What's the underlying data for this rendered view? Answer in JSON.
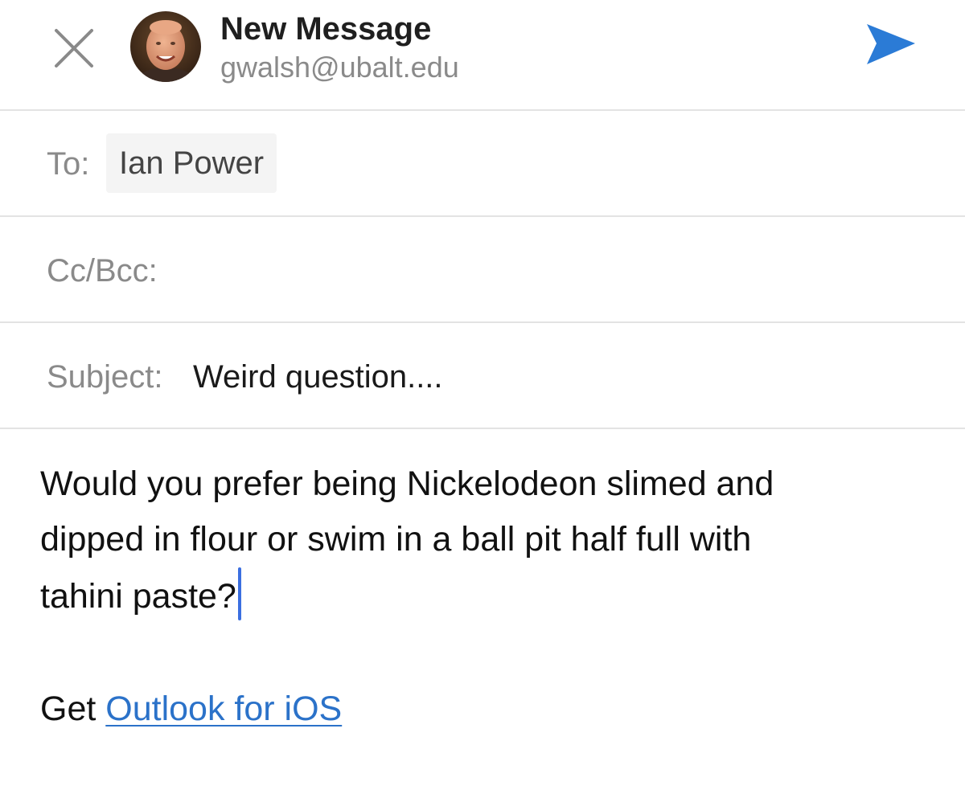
{
  "header": {
    "title": "New Message",
    "account_email": "gwalsh@ubalt.edu",
    "close_icon": "close-icon",
    "send_icon": "send-icon",
    "send_color": "#2b7bd6"
  },
  "fields": {
    "to_label": "To:",
    "to_recipient": "Ian Power",
    "cc_label": "Cc/Bcc:",
    "subject_label": "Subject:",
    "subject_value": "Weird question...."
  },
  "body": {
    "line1": "Would you prefer being Nickelodeon slimed and",
    "line2": "dipped in flour or swim in a ball pit half full with",
    "line3": "tahini paste?"
  },
  "signature": {
    "prefix": "Get",
    "link_text": "Outlook for iOS",
    "link_color": "#2b72c9"
  }
}
